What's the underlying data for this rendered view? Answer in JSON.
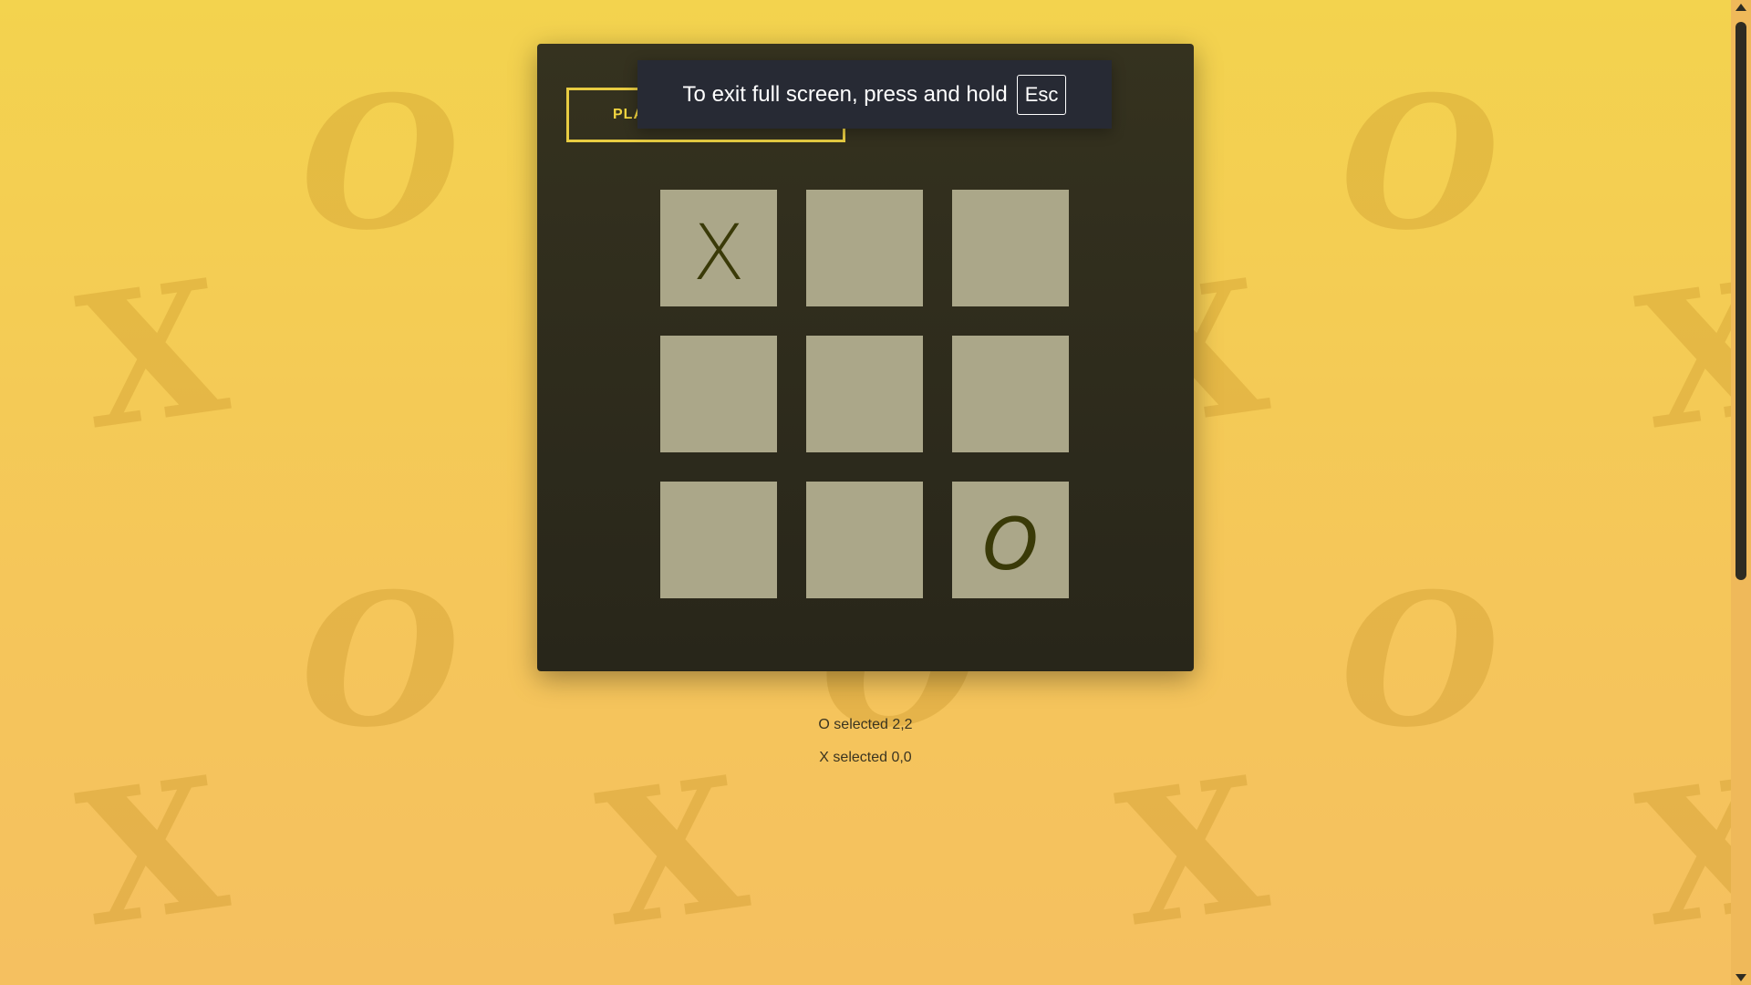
{
  "game": {
    "play_button_label": "PLA",
    "board": [
      [
        "X",
        "",
        ""
      ],
      [
        "",
        "",
        ""
      ],
      [
        "",
        "",
        "O"
      ]
    ]
  },
  "move_log": [
    "O selected 2,2",
    "X selected 0,0"
  ],
  "fullscreen_toast": {
    "message": "To exit full screen, press and hold",
    "key": "Esc"
  },
  "background_marks": [
    "O",
    "X"
  ],
  "colors": {
    "background": "#f3d34e",
    "panel": "#2f2d1f",
    "cell": "#aba789",
    "mark": "#3a3a08",
    "accent": "#e8cc42"
  }
}
